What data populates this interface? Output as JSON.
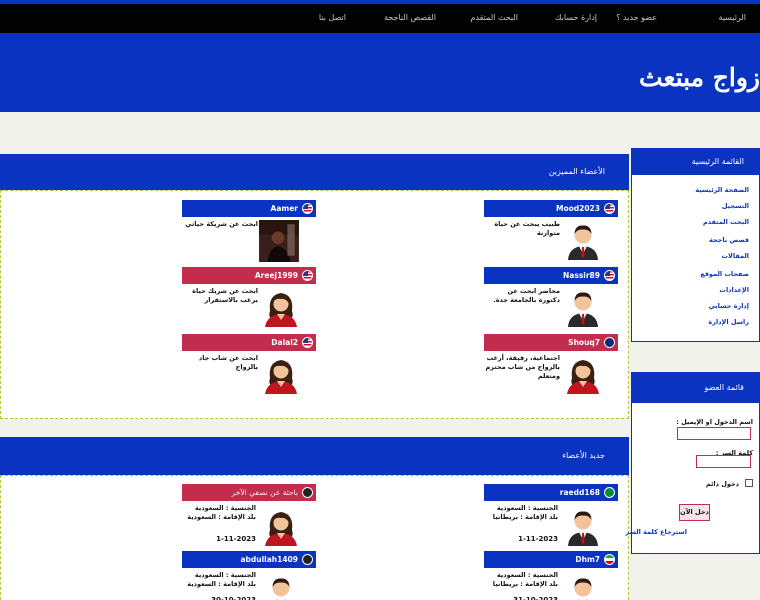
{
  "nav": {
    "items": [
      {
        "label": "الرئيسية"
      },
      {
        "label": "عضو جديد ؟"
      },
      {
        "label": "إدارة حسابك"
      },
      {
        "label": "البحث المتقدم"
      },
      {
        "label": "القصص الناجحة"
      },
      {
        "label": "اتصل بنا"
      }
    ]
  },
  "header": {
    "title": "زواج مبتعث"
  },
  "featured": {
    "title": "الأعضاء المميزين",
    "members": [
      {
        "username": "Mood2023",
        "desc": "طبيب يبحث عن حياة متوازنة",
        "gender": "male",
        "flag": "us"
      },
      {
        "username": "Aamer",
        "desc": "ابحث عن شريكة حياتي",
        "gender": "male",
        "flag": "us"
      },
      {
        "username": "Nassir89",
        "desc": "محاضر ابحث عن دكتورة بالجامعة جدة.",
        "gender": "male",
        "flag": "us"
      },
      {
        "username": "Areej1999",
        "desc": "ابحث عن شريك حياة يرغب بالاستقرار",
        "gender": "female",
        "flag": "us"
      },
      {
        "username": "Shouq7",
        "desc": "اجتماعية، رقيقة، أرغب بالزواج من شاب محترم ومتعلم",
        "gender": "female",
        "flag": "au"
      },
      {
        "username": "Dalal2",
        "desc": "ابحث عن شاب جاد بالزواج",
        "gender": "female",
        "flag": "us"
      }
    ]
  },
  "newest": {
    "title": "جديد الأعضاء",
    "members": [
      {
        "username": "raedd168",
        "tagline": "",
        "gender": "male",
        "flag": "sa",
        "nationality": "الجنسية : السعودية",
        "residence": "بلد الإقامة : بريطانيا",
        "date": "1-11-2023"
      },
      {
        "username": "",
        "tagline": "باحثة عن نصفي الآخر",
        "gender": "female",
        "flag": "dark",
        "nationality": "الجنسية : السعودية",
        "residence": "بلد الإقامة : السعودية",
        "date": "1-11-2023"
      },
      {
        "username": "Dhm7",
        "tagline": "",
        "gender": "male",
        "flag": "ir",
        "nationality": "الجنسية : السعودية",
        "residence": "بلد الإقامة : بريطانيا",
        "date": "31-10-2023"
      },
      {
        "username": "abdullah1409",
        "tagline": "",
        "gender": "male",
        "flag": "dark",
        "nationality": "الجنسية : السعودية",
        "residence": "بلد الإقامة : السعودية",
        "date": "30-10-2023"
      }
    ]
  },
  "sidebar": {
    "main_menu_title": "القائمة الرئيسية",
    "links": [
      {
        "label": "الصفحة الرئيسية"
      },
      {
        "label": "التسجيل"
      },
      {
        "label": "البحث المتقدم"
      },
      {
        "label": "قصص ناجحة"
      },
      {
        "label": "المقالات"
      },
      {
        "label": "صفحات الموقع"
      },
      {
        "label": "الإعدادات"
      },
      {
        "label": "إدارة حسابي"
      },
      {
        "label": "راسل الإدارة"
      }
    ],
    "member_menu_title": "قائمة العضو",
    "username_label": "اسم الدخول او الإيميل :",
    "password_label": "كلمة السر :",
    "remember_label": "دخول دائم",
    "login_button": "دخل الآن",
    "forgot_link": "استرجاع كلمة السر"
  },
  "colors": {
    "brand_blue": "#0a33c2",
    "female_header": "#c42c4e",
    "nav_bg": "#020202",
    "page_bg": "#f2f2ec"
  }
}
